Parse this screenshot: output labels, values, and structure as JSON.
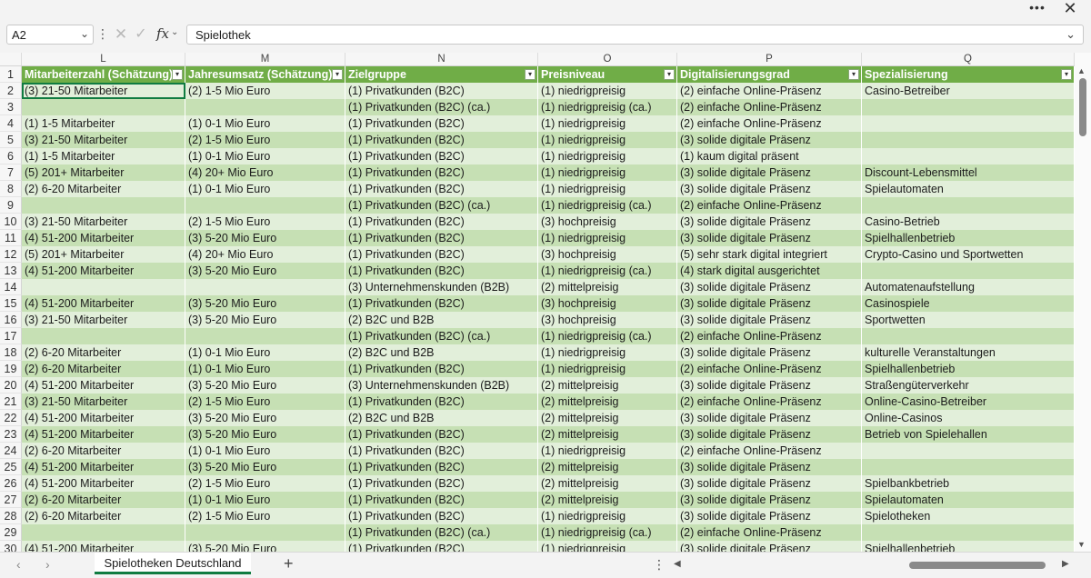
{
  "window": {
    "more_label": "•••",
    "close_label": "✕"
  },
  "formula_bar": {
    "name_box": "A2",
    "name_box_arrow": "⌄",
    "dots": "⋮",
    "cancel": "✕",
    "enter": "✓",
    "fx": "fx",
    "fx_arrow": "⌄",
    "formula": "Spielothek",
    "expand": "⌄"
  },
  "columns": [
    "L",
    "M",
    "N",
    "O",
    "P",
    "Q"
  ],
  "headers": [
    "Mitarbeiterzahl (Schätzung)",
    "Jahresumsatz (Schätzung)",
    "Zielgruppe",
    "Preisniveau",
    "Digitalisierungsgrad",
    "Spezialisierung"
  ],
  "filter_icon": "▾",
  "rows": [
    {
      "n": "2",
      "c": [
        "(3) 21-50 Mitarbeiter",
        "(2) 1-5 Mio Euro",
        "(1) Privatkunden (B2C)",
        "(1) niedrigpreisig",
        "(2) einfache Online-Präsenz",
        "Casino-Betreiber"
      ]
    },
    {
      "n": "3",
      "c": [
        "",
        "",
        "(1) Privatkunden (B2C) (ca.)",
        "(1) niedrigpreisig (ca.)",
        "(2) einfache Online-Präsenz",
        ""
      ]
    },
    {
      "n": "4",
      "c": [
        "(1) 1-5 Mitarbeiter",
        "(1) 0-1 Mio Euro",
        "(1) Privatkunden (B2C)",
        "(1) niedrigpreisig",
        "(2) einfache Online-Präsenz",
        ""
      ]
    },
    {
      "n": "5",
      "c": [
        "(3) 21-50 Mitarbeiter",
        "(2) 1-5 Mio Euro",
        "(1) Privatkunden (B2C)",
        "(1) niedrigpreisig",
        "(3) solide digitale Präsenz",
        ""
      ]
    },
    {
      "n": "6",
      "c": [
        "(1) 1-5 Mitarbeiter",
        "(1) 0-1 Mio Euro",
        "(1) Privatkunden (B2C)",
        "(1) niedrigpreisig",
        "(1) kaum digital präsent",
        ""
      ]
    },
    {
      "n": "7",
      "c": [
        "(5) 201+ Mitarbeiter",
        "(4) 20+ Mio Euro",
        "(1) Privatkunden (B2C)",
        "(1) niedrigpreisig",
        "(3) solide digitale Präsenz",
        "Discount-Lebensmittel"
      ]
    },
    {
      "n": "8",
      "c": [
        "(2) 6-20 Mitarbeiter",
        "(1) 0-1 Mio Euro",
        "(1) Privatkunden (B2C)",
        "(1) niedrigpreisig",
        "(3) solide digitale Präsenz",
        "Spielautomaten"
      ]
    },
    {
      "n": "9",
      "c": [
        "",
        "",
        "(1) Privatkunden (B2C) (ca.)",
        "(1) niedrigpreisig (ca.)",
        "(2) einfache Online-Präsenz",
        ""
      ]
    },
    {
      "n": "10",
      "c": [
        "(3) 21-50 Mitarbeiter",
        "(2) 1-5 Mio Euro",
        "(1) Privatkunden (B2C)",
        "(3) hochpreisig",
        "(3) solide digitale Präsenz",
        "Casino-Betrieb"
      ]
    },
    {
      "n": "11",
      "c": [
        "(4) 51-200 Mitarbeiter",
        "(3) 5-20 Mio Euro",
        "(1) Privatkunden (B2C)",
        "(1) niedrigpreisig",
        "(3) solide digitale Präsenz",
        "Spielhallenbetrieb"
      ]
    },
    {
      "n": "12",
      "c": [
        "(5) 201+ Mitarbeiter",
        "(4) 20+ Mio Euro",
        "(1) Privatkunden (B2C)",
        "(3) hochpreisig",
        "(5) sehr stark digital integriert",
        "Crypto-Casino und Sportwetten"
      ]
    },
    {
      "n": "13",
      "c": [
        "(4) 51-200 Mitarbeiter",
        "(3) 5-20 Mio Euro",
        "(1) Privatkunden (B2C)",
        "(1) niedrigpreisig (ca.)",
        "(4) stark digital ausgerichtet",
        ""
      ]
    },
    {
      "n": "14",
      "c": [
        "",
        "",
        "(3) Unternehmenskunden (B2B)",
        "(2) mittelpreisig",
        "(3) solide digitale Präsenz",
        "Automatenaufstellung"
      ]
    },
    {
      "n": "15",
      "c": [
        "(4) 51-200 Mitarbeiter",
        "(3) 5-20 Mio Euro",
        "(1) Privatkunden (B2C)",
        "(3) hochpreisig",
        "(3) solide digitale Präsenz",
        "Casinospiele"
      ]
    },
    {
      "n": "16",
      "c": [
        "(3) 21-50 Mitarbeiter",
        "(3) 5-20 Mio Euro",
        "(2) B2C und B2B",
        "(3) hochpreisig",
        "(3) solide digitale Präsenz",
        "Sportwetten"
      ]
    },
    {
      "n": "17",
      "c": [
        "",
        "",
        "(1) Privatkunden (B2C) (ca.)",
        "(1) niedrigpreisig (ca.)",
        "(2) einfache Online-Präsenz",
        ""
      ]
    },
    {
      "n": "18",
      "c": [
        "(2) 6-20 Mitarbeiter",
        "(1) 0-1 Mio Euro",
        "(2) B2C und B2B",
        "(1) niedrigpreisig",
        "(3) solide digitale Präsenz",
        "kulturelle Veranstaltungen"
      ]
    },
    {
      "n": "19",
      "c": [
        "(2) 6-20 Mitarbeiter",
        "(1) 0-1 Mio Euro",
        "(1) Privatkunden (B2C)",
        "(1) niedrigpreisig",
        "(2) einfache Online-Präsenz",
        "Spielhallenbetrieb"
      ]
    },
    {
      "n": "20",
      "c": [
        "(4) 51-200 Mitarbeiter",
        "(3) 5-20 Mio Euro",
        "(3) Unternehmenskunden (B2B)",
        "(2) mittelpreisig",
        "(3) solide digitale Präsenz",
        "Straßengüterverkehr"
      ]
    },
    {
      "n": "21",
      "c": [
        "(3) 21-50 Mitarbeiter",
        "(2) 1-5 Mio Euro",
        "(1) Privatkunden (B2C)",
        "(2) mittelpreisig",
        "(2) einfache Online-Präsenz",
        "Online-Casino-Betreiber"
      ]
    },
    {
      "n": "22",
      "c": [
        "(4) 51-200 Mitarbeiter",
        "(3) 5-20 Mio Euro",
        "(2) B2C und B2B",
        "(2) mittelpreisig",
        "(3) solide digitale Präsenz",
        "Online-Casinos"
      ]
    },
    {
      "n": "23",
      "c": [
        "(4) 51-200 Mitarbeiter",
        "(3) 5-20 Mio Euro",
        "(1) Privatkunden (B2C)",
        "(2) mittelpreisig",
        "(3) solide digitale Präsenz",
        "Betrieb von Spielehallen"
      ]
    },
    {
      "n": "24",
      "c": [
        "(2) 6-20 Mitarbeiter",
        "(1) 0-1 Mio Euro",
        "(1) Privatkunden (B2C)",
        "(1) niedrigpreisig",
        "(2) einfache Online-Präsenz",
        ""
      ]
    },
    {
      "n": "25",
      "c": [
        "(4) 51-200 Mitarbeiter",
        "(3) 5-20 Mio Euro",
        "(1) Privatkunden (B2C)",
        "(2) mittelpreisig",
        "(3) solide digitale Präsenz",
        ""
      ]
    },
    {
      "n": "26",
      "c": [
        "(4) 51-200 Mitarbeiter",
        "(2) 1-5 Mio Euro",
        "(1) Privatkunden (B2C)",
        "(2) mittelpreisig",
        "(3) solide digitale Präsenz",
        "Spielbankbetrieb"
      ]
    },
    {
      "n": "27",
      "c": [
        "(2) 6-20 Mitarbeiter",
        "(1) 0-1 Mio Euro",
        "(1) Privatkunden (B2C)",
        "(2) mittelpreisig",
        "(3) solide digitale Präsenz",
        "Spielautomaten"
      ]
    },
    {
      "n": "28",
      "c": [
        "(2) 6-20 Mitarbeiter",
        "(2) 1-5 Mio Euro",
        "(1) Privatkunden (B2C)",
        "(1) niedrigpreisig",
        "(3) solide digitale Präsenz",
        "Spielotheken"
      ]
    },
    {
      "n": "29",
      "c": [
        "",
        "",
        "(1) Privatkunden (B2C) (ca.)",
        "(1) niedrigpreisig (ca.)",
        "(2) einfache Online-Präsenz",
        ""
      ]
    },
    {
      "n": "30",
      "c": [
        "(4) 51-200 Mitarbeiter",
        "(3) 5-20 Mio Euro",
        "(1) Privatkunden (B2C)",
        "(1) niedrigpreisig",
        "(3) solide digitale Präsenz",
        "Spielhallenbetrieb"
      ]
    }
  ],
  "header_row_number": "1",
  "sheet_bar": {
    "prev": "‹",
    "next": "›",
    "sheet_name": "Spielotheken Deutschland",
    "add": "+",
    "dots": "⋮",
    "scroll_left": "◀",
    "scroll_right": "▶"
  },
  "scrollbar": {
    "up": "▲",
    "down": "▼"
  },
  "colors": {
    "header_fill": "#70ad47",
    "band_light": "#e2efda",
    "band_dark": "#c6e0b4",
    "accent": "#107c41"
  }
}
